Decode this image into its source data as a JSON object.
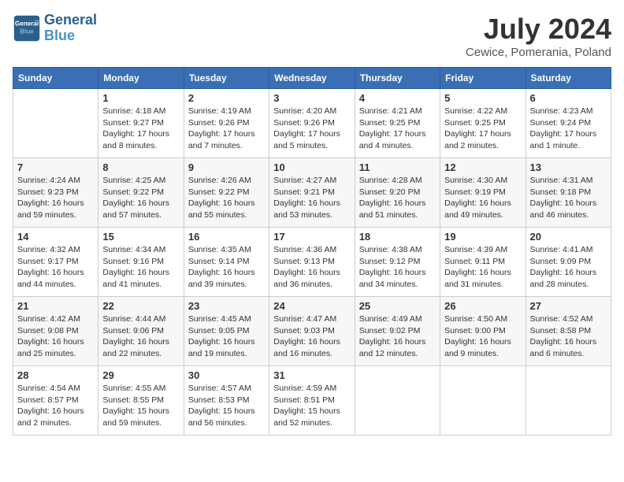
{
  "header": {
    "logo_line1": "General",
    "logo_line2": "Blue",
    "month_title": "July 2024",
    "location": "Cewice, Pomerania, Poland"
  },
  "weekdays": [
    "Sunday",
    "Monday",
    "Tuesday",
    "Wednesday",
    "Thursday",
    "Friday",
    "Saturday"
  ],
  "weeks": [
    [
      {
        "day": "",
        "info": ""
      },
      {
        "day": "1",
        "info": "Sunrise: 4:18 AM\nSunset: 9:27 PM\nDaylight: 17 hours\nand 8 minutes."
      },
      {
        "day": "2",
        "info": "Sunrise: 4:19 AM\nSunset: 9:26 PM\nDaylight: 17 hours\nand 7 minutes."
      },
      {
        "day": "3",
        "info": "Sunrise: 4:20 AM\nSunset: 9:26 PM\nDaylight: 17 hours\nand 5 minutes."
      },
      {
        "day": "4",
        "info": "Sunrise: 4:21 AM\nSunset: 9:25 PM\nDaylight: 17 hours\nand 4 minutes."
      },
      {
        "day": "5",
        "info": "Sunrise: 4:22 AM\nSunset: 9:25 PM\nDaylight: 17 hours\nand 2 minutes."
      },
      {
        "day": "6",
        "info": "Sunrise: 4:23 AM\nSunset: 9:24 PM\nDaylight: 17 hours\nand 1 minute."
      }
    ],
    [
      {
        "day": "7",
        "info": "Sunrise: 4:24 AM\nSunset: 9:23 PM\nDaylight: 16 hours\nand 59 minutes."
      },
      {
        "day": "8",
        "info": "Sunrise: 4:25 AM\nSunset: 9:22 PM\nDaylight: 16 hours\nand 57 minutes."
      },
      {
        "day": "9",
        "info": "Sunrise: 4:26 AM\nSunset: 9:22 PM\nDaylight: 16 hours\nand 55 minutes."
      },
      {
        "day": "10",
        "info": "Sunrise: 4:27 AM\nSunset: 9:21 PM\nDaylight: 16 hours\nand 53 minutes."
      },
      {
        "day": "11",
        "info": "Sunrise: 4:28 AM\nSunset: 9:20 PM\nDaylight: 16 hours\nand 51 minutes."
      },
      {
        "day": "12",
        "info": "Sunrise: 4:30 AM\nSunset: 9:19 PM\nDaylight: 16 hours\nand 49 minutes."
      },
      {
        "day": "13",
        "info": "Sunrise: 4:31 AM\nSunset: 9:18 PM\nDaylight: 16 hours\nand 46 minutes."
      }
    ],
    [
      {
        "day": "14",
        "info": "Sunrise: 4:32 AM\nSunset: 9:17 PM\nDaylight: 16 hours\nand 44 minutes."
      },
      {
        "day": "15",
        "info": "Sunrise: 4:34 AM\nSunset: 9:16 PM\nDaylight: 16 hours\nand 41 minutes."
      },
      {
        "day": "16",
        "info": "Sunrise: 4:35 AM\nSunset: 9:14 PM\nDaylight: 16 hours\nand 39 minutes."
      },
      {
        "day": "17",
        "info": "Sunrise: 4:36 AM\nSunset: 9:13 PM\nDaylight: 16 hours\nand 36 minutes."
      },
      {
        "day": "18",
        "info": "Sunrise: 4:38 AM\nSunset: 9:12 PM\nDaylight: 16 hours\nand 34 minutes."
      },
      {
        "day": "19",
        "info": "Sunrise: 4:39 AM\nSunset: 9:11 PM\nDaylight: 16 hours\nand 31 minutes."
      },
      {
        "day": "20",
        "info": "Sunrise: 4:41 AM\nSunset: 9:09 PM\nDaylight: 16 hours\nand 28 minutes."
      }
    ],
    [
      {
        "day": "21",
        "info": "Sunrise: 4:42 AM\nSunset: 9:08 PM\nDaylight: 16 hours\nand 25 minutes."
      },
      {
        "day": "22",
        "info": "Sunrise: 4:44 AM\nSunset: 9:06 PM\nDaylight: 16 hours\nand 22 minutes."
      },
      {
        "day": "23",
        "info": "Sunrise: 4:45 AM\nSunset: 9:05 PM\nDaylight: 16 hours\nand 19 minutes."
      },
      {
        "day": "24",
        "info": "Sunrise: 4:47 AM\nSunset: 9:03 PM\nDaylight: 16 hours\nand 16 minutes."
      },
      {
        "day": "25",
        "info": "Sunrise: 4:49 AM\nSunset: 9:02 PM\nDaylight: 16 hours\nand 12 minutes."
      },
      {
        "day": "26",
        "info": "Sunrise: 4:50 AM\nSunset: 9:00 PM\nDaylight: 16 hours\nand 9 minutes."
      },
      {
        "day": "27",
        "info": "Sunrise: 4:52 AM\nSunset: 8:58 PM\nDaylight: 16 hours\nand 6 minutes."
      }
    ],
    [
      {
        "day": "28",
        "info": "Sunrise: 4:54 AM\nSunset: 8:57 PM\nDaylight: 16 hours\nand 2 minutes."
      },
      {
        "day": "29",
        "info": "Sunrise: 4:55 AM\nSunset: 8:55 PM\nDaylight: 15 hours\nand 59 minutes."
      },
      {
        "day": "30",
        "info": "Sunrise: 4:57 AM\nSunset: 8:53 PM\nDaylight: 15 hours\nand 56 minutes."
      },
      {
        "day": "31",
        "info": "Sunrise: 4:59 AM\nSunset: 8:51 PM\nDaylight: 15 hours\nand 52 minutes."
      },
      {
        "day": "",
        "info": ""
      },
      {
        "day": "",
        "info": ""
      },
      {
        "day": "",
        "info": ""
      }
    ]
  ]
}
